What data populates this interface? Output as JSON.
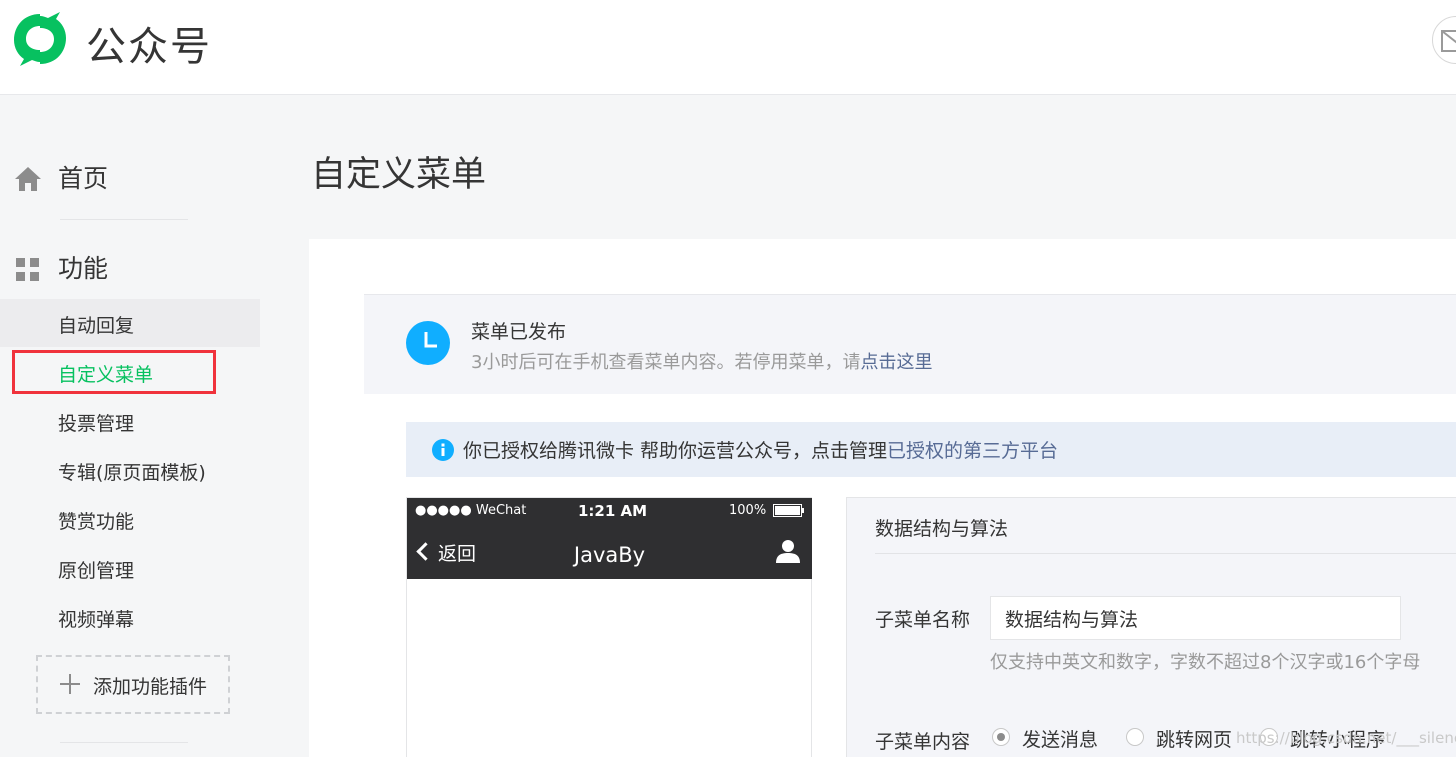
{
  "header": {
    "brand": "公众号",
    "brand_color": "#07c160"
  },
  "sidebar": {
    "home": {
      "label": "首页",
      "icon": "home-icon"
    },
    "features": {
      "label": "功能",
      "icon": "grid-icon"
    },
    "items": [
      {
        "label": "自动回复",
        "state": "hover"
      },
      {
        "label": "自定义菜单",
        "state": "active"
      },
      {
        "label": "投票管理",
        "state": ""
      },
      {
        "label": "专辑(原页面模板)",
        "state": ""
      },
      {
        "label": "赞赏功能",
        "state": ""
      },
      {
        "label": "原创管理",
        "state": ""
      },
      {
        "label": "视频弹幕",
        "state": ""
      }
    ],
    "add_plugin": "添加功能插件"
  },
  "main": {
    "title": "自定义菜单",
    "notice": {
      "title": "菜单已发布",
      "desc": "3小时后可在手机查看菜单内容。若停用菜单，请",
      "link": "点击这里"
    },
    "auth": {
      "text": "你已授权给腾讯微卡  帮助你运营公众号，点击管理",
      "link": "已授权的第三方平台"
    },
    "phone": {
      "carrier": "●●●●● WeChat",
      "time": "1:21 AM",
      "battery": "100%",
      "back": "返回",
      "title": "JavaBy"
    },
    "editor": {
      "title": "数据结构与算法",
      "name_label": "子菜单名称",
      "name_value": "数据结构与算法",
      "name_hint": "仅支持中英文和数字，字数不超过8个汉字或16个字母",
      "content_label": "子菜单内容",
      "options": [
        {
          "label": "发送消息",
          "checked": true
        },
        {
          "label": "跳转网页",
          "checked": false
        },
        {
          "label": "跳转小程序",
          "checked": false
        }
      ]
    },
    "watermark": "https://blog.csdn.net/___silence"
  },
  "colors": {
    "accent": "#07c160",
    "link": "#576b95",
    "highlight": "#f0323c",
    "info": "#10aeff"
  }
}
